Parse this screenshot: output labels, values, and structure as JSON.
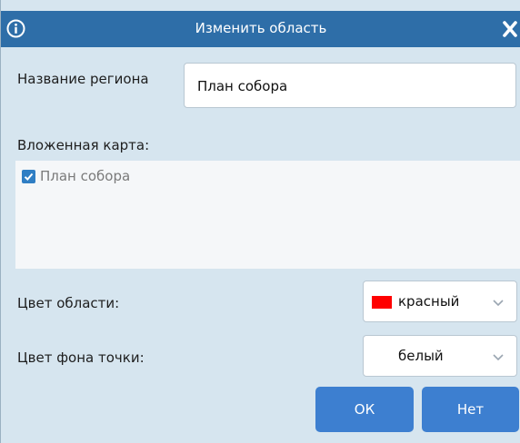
{
  "dialog": {
    "title": "Изменить область",
    "icons": {
      "info": "info-icon",
      "close": "close-icon"
    }
  },
  "region_name": {
    "label": "Название региона",
    "value": "План собора"
  },
  "nested_map": {
    "label": "Вложенная карта:",
    "items": [
      {
        "label": "План собора",
        "checked": true
      }
    ]
  },
  "area_color": {
    "label": "Цвет области:",
    "selected": "красный",
    "swatch": "#ff0000"
  },
  "point_bg_color": {
    "label": "Цвет фона точки:",
    "selected": "белый",
    "swatch": "#ffffff"
  },
  "buttons": {
    "ok": "ОК",
    "no": "Нет"
  },
  "colors": {
    "titlebar": "#2e6ea8",
    "dialog_bg": "#d6e5ef",
    "button": "#3d7fd0",
    "checkbox": "#2f7ec4"
  }
}
